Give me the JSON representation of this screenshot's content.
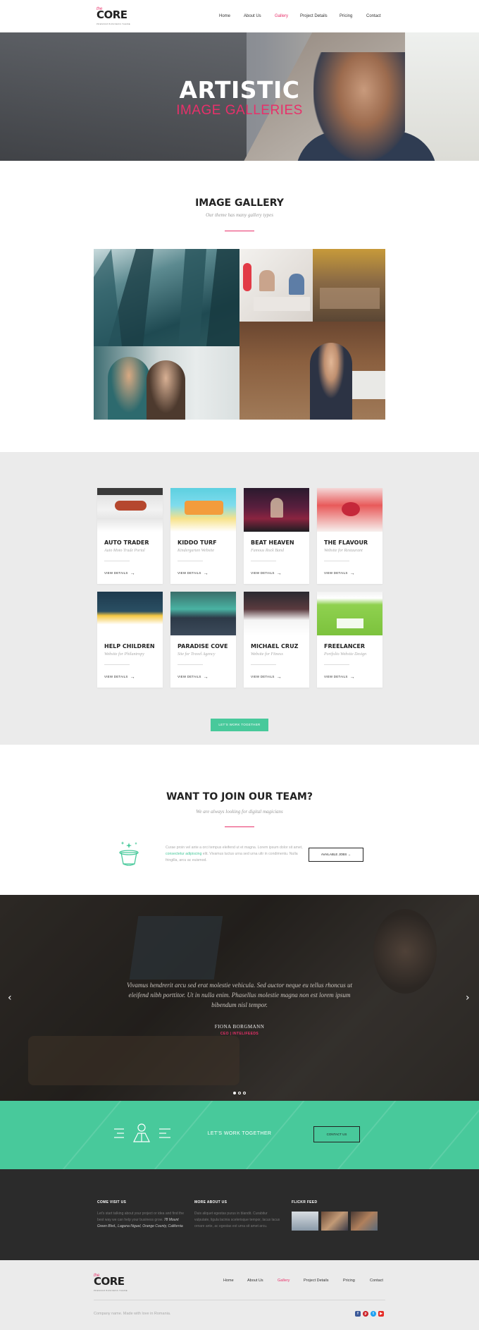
{
  "brand": {
    "name": "CORE",
    "prefix": "the",
    "tagline": "PREMIUM BUSINESS THEME"
  },
  "nav": {
    "items": [
      "Home",
      "About Us",
      "Gallery",
      "Project Details",
      "Pricing",
      "Contact"
    ],
    "active": "Gallery"
  },
  "hero": {
    "title": "ARTISTIC",
    "subtitle": "IMAGE GALLERIES"
  },
  "gallery": {
    "title": "IMAGE GALLERY",
    "subtitle": "Our theme has many gallery types"
  },
  "portfolio": {
    "cards": [
      {
        "title": "AUTO TRADER",
        "subtitle": "Auto Moto Trade Portal",
        "link": "VIEW DETAILS"
      },
      {
        "title": "KIDDO TURF",
        "subtitle": "Kindergarten Website",
        "link": "VIEW DETAILS"
      },
      {
        "title": "BEAT HEAVEN",
        "subtitle": "Famous Rock Band",
        "link": "VIEW DETAILS"
      },
      {
        "title": "THE FLAVOUR",
        "subtitle": "Website for Restaurant",
        "link": "VIEW DETAILS"
      },
      {
        "title": "HELP CHILDREN",
        "subtitle": "Website for Philantropy",
        "link": "VIEW DETAILS"
      },
      {
        "title": "PARADISE COVE",
        "subtitle": "Site for Travel Agency",
        "link": "VIEW DETAILS"
      },
      {
        "title": "MICHAEL CRUZ",
        "subtitle": "Website for Fitness",
        "link": "VIEW DETAILS"
      },
      {
        "title": "FREELANCER",
        "subtitle": "Portfolio Website Design",
        "link": "VIEW DETAILS"
      }
    ],
    "button": "LET'S WORK TOGETHER"
  },
  "join": {
    "title": "WANT TO JOIN OUR TEAM?",
    "subtitle": "We are always looking for digital magicians",
    "text_before": "Curae proin vel ante a orci tempus eleifend ut et magna. Lorem ipsum dolor sit amet, ",
    "text_link": "consectetur adipiscing",
    "text_after": " elit. Vivamus luctus urna sed urna ultr in condimentu. Nulla fringilla, arcu ac euismod.",
    "button": "AVAILABLE JOBS →"
  },
  "testimonial": {
    "quote": "Vivamus hendrerit arcu sed erat molestie vehicula. Sed auctor neque eu tellus rhoncus ut eleifend nibh porttitor. Ut in nulla enim. Phasellus molestie magna non est lorem ipsum bibendum nisl tempor.",
    "name": "FIONA BORGMANN",
    "role": "CEO | INTELIFEEDS"
  },
  "cta": {
    "text": "LET'S WORK TOGETHER",
    "button": "CONTACT US"
  },
  "footer": {
    "col1_title": "COME VISIT US",
    "col1_text": "Let's start talking about your project or idea and find the best way we can help your business grow. ",
    "col1_address": "78 Mount Green Blvd., Laguna Niguel, Orange County, California",
    "col2_title": "MORE ABOUT US",
    "col2_text": "Duis aliquet egestas purus in blandit. Curabitur vulputate, ligula lacinia scelerisque tempor, lacus lacus ornare ante, ac egestas est urna sit amet arcu.",
    "col3_title": "FLICKR FEED",
    "copyright": "Company name. Made with love in Romania."
  },
  "colors": {
    "accent": "#e8306a",
    "green": "#48c99b",
    "dark": "#2b2b2b",
    "gray": "#ebebeb"
  }
}
